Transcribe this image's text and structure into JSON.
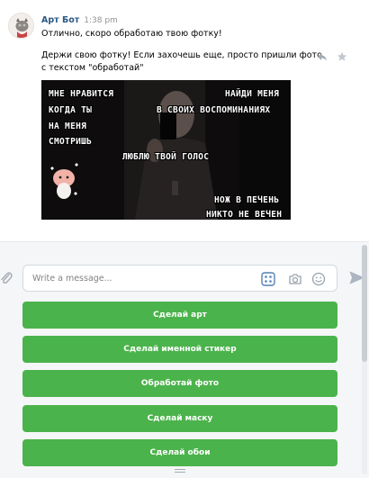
{
  "message": {
    "sender": "Арт Бот",
    "time": "1:38 pm",
    "line1": "Отлично, скоро обработаю твою фотку!",
    "line2": "Держи свою фотку! Если захочешь еще, просто пришли фото",
    "line3": "с текстом \"обработай\""
  },
  "photo": {
    "captions": [
      "МНЕ НРАВИТСЯ",
      "КОГДА ТЫ",
      "НА МЕНЯ",
      "СМОТРИШЬ",
      "НАЙДИ МЕНЯ",
      "В СВОИХ ВОСПОМИНАНИЯХ",
      "ЛЮБЛЮ ТВОЙ ГОЛОС",
      "НОЖ В ПЕЧЕНЬ",
      "НИКТО НЕ ВЕЧЕН"
    ]
  },
  "composer": {
    "placeholder": "Write a message..."
  },
  "keyboard": {
    "buttons": [
      "Сделай арт",
      "Сделай именной стикер",
      "Обработай фото",
      "Сделай маску",
      "Сделай обои"
    ]
  },
  "colors": {
    "button_green": "#4bb34b",
    "link_blue": "#2a5885",
    "time_gray": "#939393",
    "composer_bg": "#f5f6f8"
  },
  "icons": {
    "avatar": "cat-avatar-icon",
    "reply": "reply-icon",
    "favorite": "star-icon",
    "attach": "paperclip-icon",
    "bot_keyboard": "keyboard-icon",
    "camera": "camera-icon",
    "emoji": "emoji-icon",
    "send": "send-icon"
  }
}
